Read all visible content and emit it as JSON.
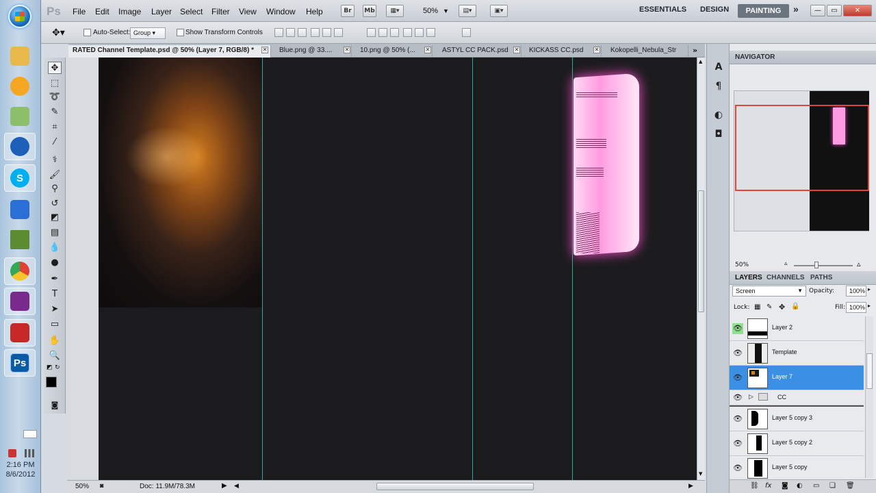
{
  "taskbar": {
    "apps": [
      {
        "name": "windows-explorer-icon",
        "label": "",
        "color": "#e8b94a"
      },
      {
        "name": "messenger-icon",
        "label": "",
        "color": "#f5a623"
      },
      {
        "name": "notes-icon",
        "label": "",
        "color": "#8dbf6a"
      },
      {
        "name": "globe-app-icon",
        "label": "",
        "color": "#1e5fb8"
      },
      {
        "name": "skype-icon",
        "label": "S",
        "color": "#00aff0"
      },
      {
        "name": "pen-app-icon",
        "label": "",
        "color": "#2a6fd6"
      },
      {
        "name": "minecraft-icon",
        "label": "",
        "color": "#5b8c32"
      },
      {
        "name": "chrome-icon",
        "label": "",
        "color": "#e34133"
      },
      {
        "name": "winrar-icon",
        "label": "",
        "color": "#7a2a8c"
      },
      {
        "name": "camera-app-icon",
        "label": "",
        "color": "#c62828"
      },
      {
        "name": "photoshop-icon",
        "label": "Ps",
        "color": "#0b5aa6"
      }
    ],
    "time": "2:16 PM",
    "date": "8/6/2012"
  },
  "appbar": {
    "logo": "Ps",
    "menus": [
      "File",
      "Edit",
      "Image",
      "Layer",
      "Select",
      "Filter",
      "View",
      "Window",
      "Help"
    ],
    "bridge_label": "Br",
    "minibridge_label": "Mb",
    "zoom": "50%",
    "workspaces": [
      "ESSENTIALS",
      "DESIGN",
      "PAINTING"
    ],
    "more": "»"
  },
  "options": {
    "auto_select_label": "Auto-Select:",
    "auto_select_value": "Group",
    "transform_label": "Show Transform Controls"
  },
  "tabs": [
    {
      "label": "RATED Channel Template.psd @ 50% (Layer 7, RGB/8) *",
      "active": true
    },
    {
      "label": "Blue.png @ 33....",
      "active": false
    },
    {
      "label": "10.png @ 50% (...",
      "active": false
    },
    {
      "label": "ASTYL CC PACK.psd",
      "active": false
    },
    {
      "label": "KICKASS CC.psd",
      "active": false
    },
    {
      "label": "Kokopelli_Nebula_Str",
      "active": false
    }
  ],
  "status": {
    "zoom": "50%",
    "doc": "Doc: 11.9M/78.3M"
  },
  "navigator": {
    "title": "NAVIGATOR",
    "zoom": "50%"
  },
  "layers": {
    "tabs": [
      "LAYERS",
      "CHANNELS",
      "PATHS"
    ],
    "blend_mode": "Screen",
    "opacity_label": "Opacity:",
    "opacity_value": "100%",
    "lock_label": "Lock:",
    "fill_label": "Fill:",
    "fill_value": "100%",
    "items": [
      {
        "name": "Layer 2",
        "selected": false
      },
      {
        "name": "Template",
        "selected": false
      },
      {
        "name": "Layer 7",
        "selected": true
      },
      {
        "name": "CC",
        "selected": false,
        "group": true
      },
      {
        "name": "Layer 5 copy 3",
        "selected": false
      },
      {
        "name": "Layer 5 copy 2",
        "selected": false
      },
      {
        "name": "Layer 5 copy",
        "selected": false
      }
    ]
  },
  "colors": {
    "selection": "#3b8fe4",
    "guide": "#2fd0c6",
    "canvas": "#1b1b1d",
    "painting_ws": "#6b7580"
  }
}
